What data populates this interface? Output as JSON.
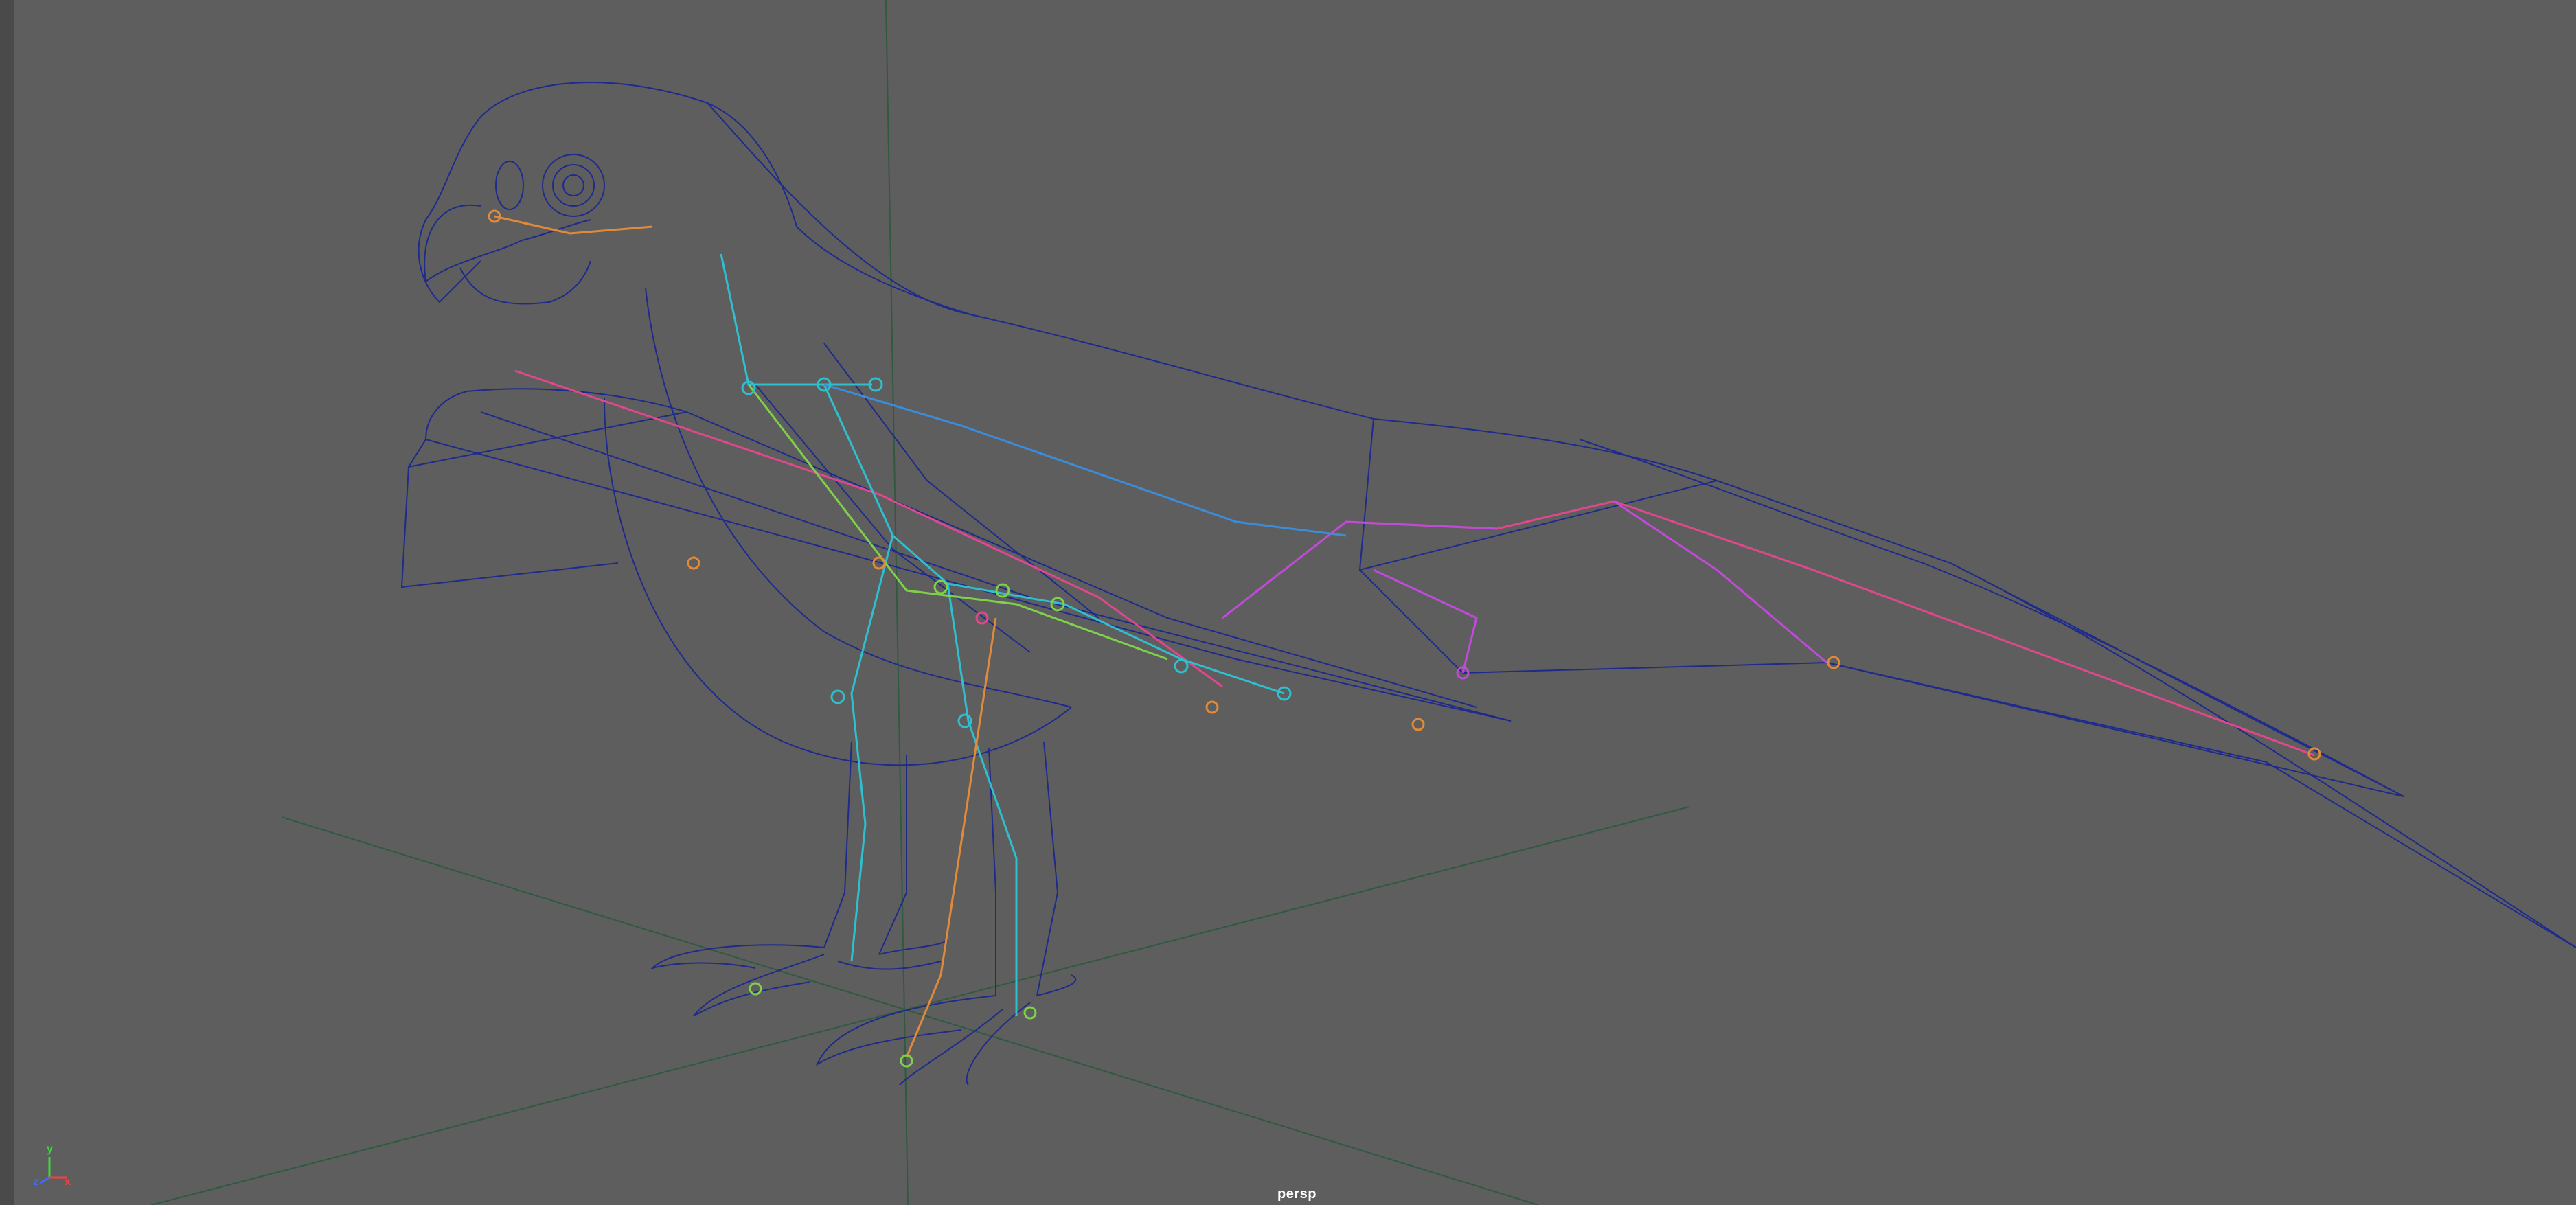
{
  "viewport": {
    "camera_name": "persp",
    "background_color": "#5e5e5e",
    "grid_color": "#2f5a3f",
    "wireframe_color": "#1e2a8c"
  },
  "axis_gizmo": {
    "y_label": "y",
    "z_label": "z",
    "x_label": "x",
    "y_color": "#3ddc3d",
    "z_color": "#3d6cff",
    "x_color": "#ff3d3d"
  },
  "skeleton": {
    "colors": [
      "#e0488c",
      "#c04bd9",
      "#2fbfcf",
      "#7fd14a",
      "#e08a3a",
      "#3b8cd9"
    ]
  },
  "model": {
    "icon": "bird-wireframe-icon"
  }
}
